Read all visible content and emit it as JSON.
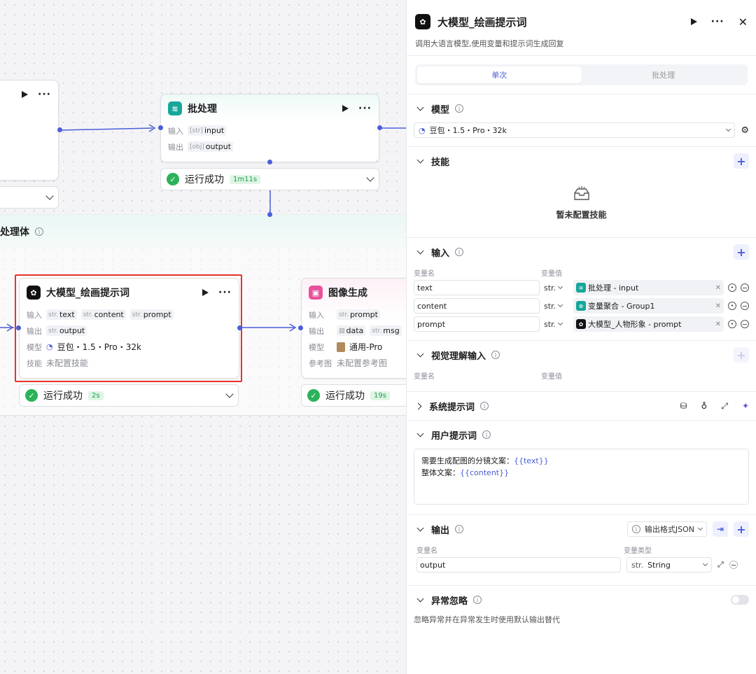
{
  "canvas": {
    "batch_body_title": "处理体",
    "batch_node": {
      "title": "批处理",
      "input_label": "输入",
      "input_chip": "input",
      "output_label": "输出",
      "output_chip": "output",
      "status": "运行成功",
      "time": "1m11s"
    },
    "llm_node": {
      "title": "大模型_绘画提示词",
      "input_label": "输入",
      "inputs": [
        "text",
        "content",
        "prompt"
      ],
      "output_label": "输出",
      "output_chip": "output",
      "model_label": "模型",
      "model_value": "豆包・1.5・Pro・32k",
      "skill_label": "技能",
      "skill_value": "未配置技能",
      "status": "运行成功",
      "time": "2s"
    },
    "image_node": {
      "title": "图像生成",
      "input_label": "输入",
      "input_chip": "prompt",
      "output_label": "输出",
      "outputs": [
        "data",
        "msg"
      ],
      "model_label": "模型",
      "model_value": "通用-Pro",
      "ref_label": "参考图",
      "ref_value": "未配置参考图",
      "status": "运行成功",
      "time": "19s"
    },
    "type_str": "str."
  },
  "panel": {
    "title": "大模型_绘画提示词",
    "description": "调用大语言模型,使用变量和提示词生成回复",
    "tabs": [
      {
        "label": "单次",
        "active": true
      },
      {
        "label": "批处理",
        "active": false
      }
    ],
    "model": {
      "title": "模型",
      "value": "豆包・1.5・Pro・32k"
    },
    "skills": {
      "title": "技能",
      "empty": "暂未配置技能"
    },
    "inputs": {
      "title": "输入",
      "col_name": "变量名",
      "col_value": "变量值",
      "rows": [
        {
          "name": "text",
          "type": "str.",
          "ref": "批处理 - input"
        },
        {
          "name": "content",
          "type": "str.",
          "ref": "变量聚合 - Group1"
        },
        {
          "name": "prompt",
          "type": "str.",
          "ref": "大模型_人物形象 - prompt"
        }
      ]
    },
    "vision": {
      "title": "视觉理解输入",
      "col_name": "变量名",
      "col_value": "变量值"
    },
    "system_prompt": {
      "title": "系统提示词"
    },
    "user_prompt": {
      "title": "用户提示词",
      "line1_text": "需要生成配图的分镜文案：",
      "line1_var": "{{text}}",
      "line2_text": "整体文案：",
      "line2_var": "{{content}}"
    },
    "output": {
      "title": "输出",
      "format": "输出格式JSON",
      "col_name": "变量名",
      "col_type": "变量类型",
      "name": "output",
      "type_prefix": "str.",
      "type": "String"
    },
    "error_ignore": {
      "title": "异常忽略",
      "description": "忽略异常并在异常发生时使用默认输出替代"
    }
  },
  "colors": {
    "accent": "#4a5ed8",
    "success": "#2cb25a",
    "highlight": "#e8332b"
  }
}
